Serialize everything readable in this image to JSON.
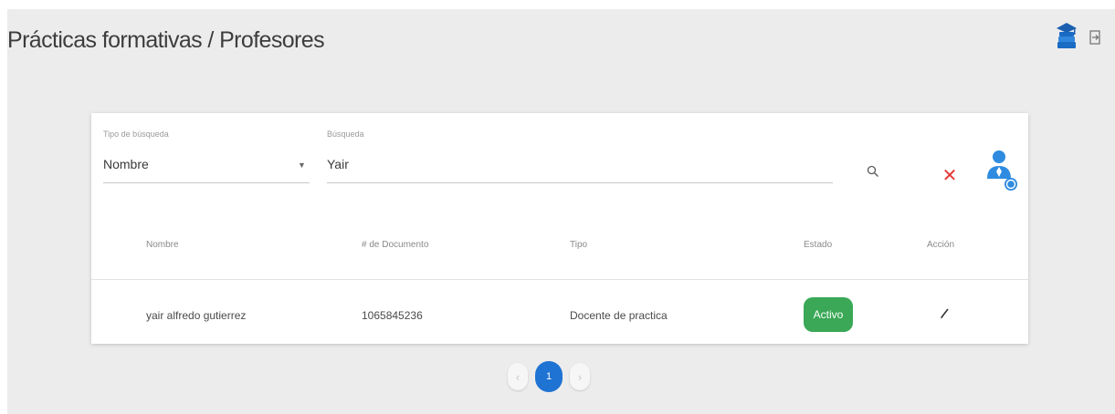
{
  "header": {
    "title": "Prácticas formativas / Profesores",
    "icons": [
      "graduation-cap-books-icon",
      "logout-icon"
    ]
  },
  "filters": {
    "search_type": {
      "label": "Tipo de búsqueda",
      "value": "Nombre"
    },
    "search": {
      "label": "Búsqueda",
      "value": "Yair"
    },
    "icons": [
      "search-icon",
      "clear-icon",
      "add-user-icon"
    ]
  },
  "table": {
    "columns": [
      "Nombre",
      "# de Documento",
      "Tipo",
      "Estado",
      "Acción"
    ],
    "rows": [
      {
        "nombre": "yair alfredo gutierrez",
        "documento": "1065845236",
        "tipo": "Docente de practica",
        "estado": "Activo",
        "accion_icon": "edit-icon"
      }
    ]
  },
  "pagination": {
    "prev": "‹",
    "current_page": "1",
    "next": "›"
  },
  "colors": {
    "accent_blue": "#1f73d3",
    "status_active": "#3aa856",
    "clear_red": "#e53935",
    "background": "#ececec"
  }
}
